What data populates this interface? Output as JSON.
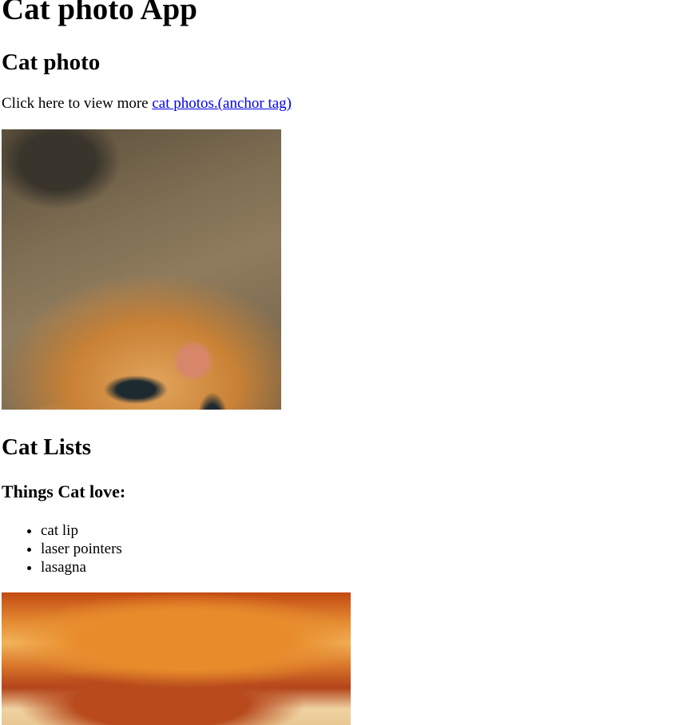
{
  "page": {
    "title": "Cat photo App"
  },
  "photo_section": {
    "heading": "Cat photo",
    "intro_text": "Click here to view more ",
    "link_text": "cat photos.(anchor tag)",
    "image_name": "kitten-lying-on-back-photo"
  },
  "lists_section": {
    "heading": "Cat Lists",
    "subheading": "Things Cat love:",
    "items": [
      "cat lip",
      "laser pointers",
      "lasagna"
    ],
    "image_name": "lasagna-photo"
  },
  "colors": {
    "link": "#0000ee",
    "text": "#000000",
    "background": "#ffffff"
  }
}
